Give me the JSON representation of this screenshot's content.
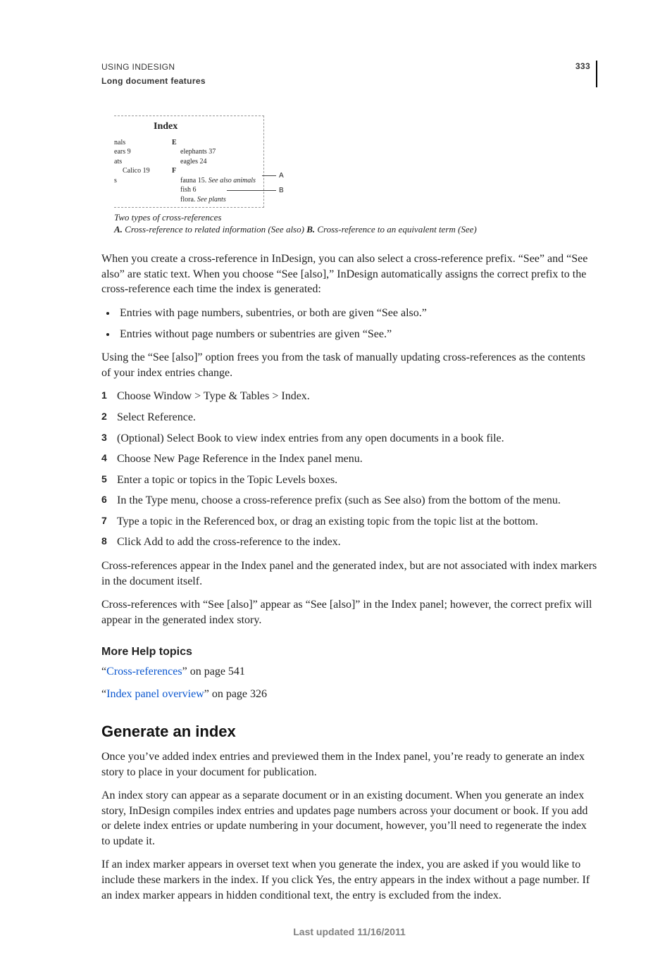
{
  "header": {
    "title": "USING INDESIGN",
    "subtitle": "Long document features",
    "page_number": "333"
  },
  "figure": {
    "index_title": "Index",
    "left_col": [
      "nals",
      "ears  9",
      "ats",
      "Calico  19",
      "",
      "s"
    ],
    "right_letters": [
      "E",
      "F"
    ],
    "right_e": [
      "elephants  37",
      "eagles 24"
    ],
    "right_f_prefix": "fauna 15. ",
    "right_f_xref_a": "See also animals",
    "right_f2": "fish  6",
    "right_f3_prefix": "flora. ",
    "right_f3_xref_b": "See plants",
    "callout_a": "A",
    "callout_b": "B",
    "caption_line1": "Two types of cross-references",
    "caption_a_bold": "A.",
    "caption_a": " Cross-reference to related information (See also)  ",
    "caption_b_bold": "B.",
    "caption_b": " Cross-reference to an equivalent term (See)"
  },
  "para_intro": "When you create a cross-reference in InDesign, you can also select a cross-reference prefix. “See” and “See also” are static text. When you choose “See [also],” InDesign automatically assigns the correct prefix to the cross-reference each time the index is generated:",
  "bullets": [
    "Entries with page numbers, subentries, or both are given “See also.”",
    "Entries without page numbers or subentries are given “See.”"
  ],
  "para_after_bullets": "Using the “See [also]” option frees you from the task of manually updating cross-references as the contents of your index entries change.",
  "steps": [
    "Choose Window > Type & Tables > Index.",
    "Select Reference.",
    "(Optional) Select Book to view index entries from any open documents in a book file.",
    "Choose New Page Reference in the Index panel menu.",
    "Enter a topic or topics in the Topic Levels boxes.",
    "In the Type menu, choose a cross-reference prefix (such as See also) from the bottom of the menu.",
    "Type a topic in the Referenced box, or drag an existing topic from the topic list at the bottom.",
    "Click Add to add the cross-reference to the index."
  ],
  "para_after_steps_1": "Cross-references appear in the Index panel and the generated index, but are not associated with index markers in the document itself.",
  "para_after_steps_2": "Cross-references with “See [also]” appear as “See [also]” in the Index panel; however, the correct prefix will appear in the generated index story.",
  "help": {
    "heading": "More Help topics",
    "items": [
      {
        "link": "Cross-references",
        "suffix": "” on page 541"
      },
      {
        "link": "Index panel overview",
        "suffix": "” on page 326"
      }
    ],
    "quote_open": "“"
  },
  "section2": {
    "heading": "Generate an index",
    "p1": "Once you’ve added index entries and previewed them in the Index panel, you’re ready to generate an index story to place in your document for publication.",
    "p2": "An index story can appear as a separate document or in an existing document. When you generate an index story, InDesign compiles index entries and updates page numbers across your document or book. If you add or delete index entries or update numbering in your document, however, you’ll need to regenerate the index to update it.",
    "p3": "If an index marker appears in overset text when you generate the index, you are asked if you would like to include these markers in the index. If you click Yes, the entry appears in the index without a page number. If an index marker appears in hidden conditional text, the entry is excluded from the index."
  },
  "footer": "Last updated 11/16/2011"
}
